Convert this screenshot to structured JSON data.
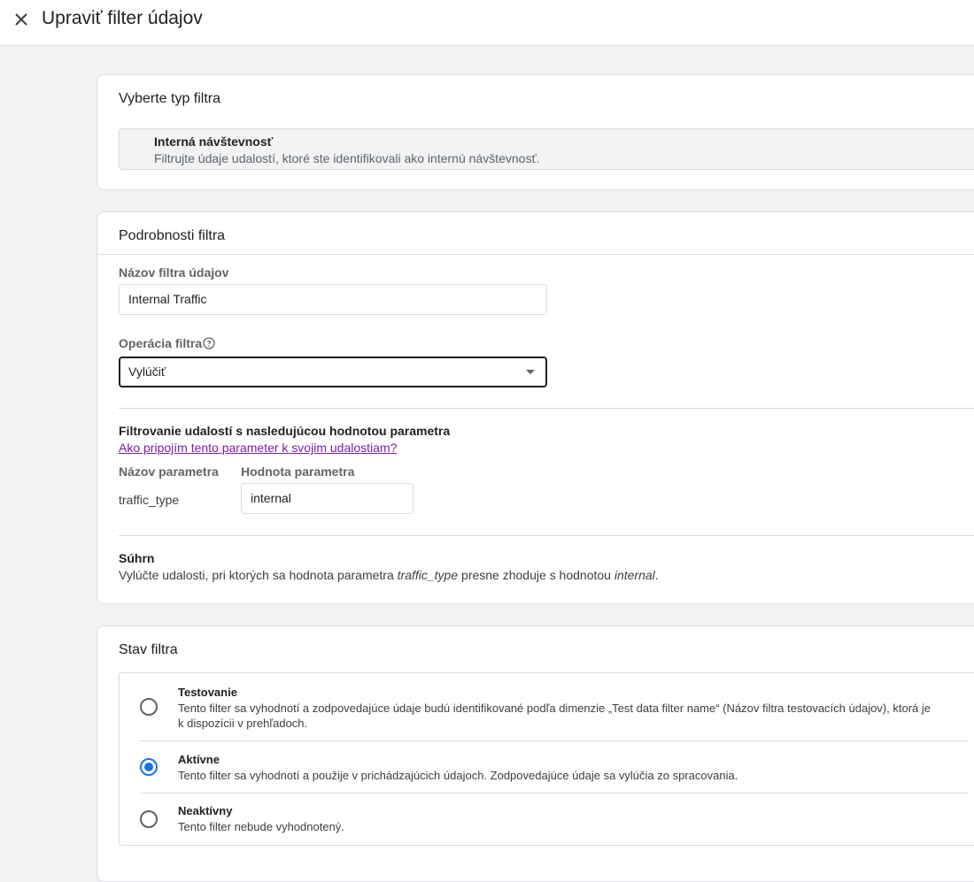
{
  "header": {
    "title": "Upraviť filter údajov"
  },
  "filter_type": {
    "title": "Vyberte typ filtra",
    "selected_name": "Interná návštevnosť",
    "selected_desc": "Filtrujte údaje udalostí, ktoré ste identifikovali ako internú návštevnosť."
  },
  "details": {
    "title": "Podrobnosti filtra",
    "name_label": "Názov filtra údajov",
    "name_value": "Internal Traffic",
    "operation_label": "Operácia filtra",
    "operation_value": "Vylúčiť",
    "param_heading": "Filtrovanie udalostí s nasledujúcou hodnotou parametra",
    "param_link": "Ako pripojím tento parameter k svojim udalostiam?",
    "param_name_label": "Názov parametra",
    "param_value_label": "Hodnota parametra",
    "param_name": "traffic_type",
    "param_value": "internal",
    "summary_heading": "Súhrn",
    "summary_pre": "Vylúčte udalosti, pri ktorých sa hodnota parametra ",
    "summary_param": "traffic_type",
    "summary_mid": " presne zhoduje s hodnotou ",
    "summary_value": "internal",
    "summary_end": "."
  },
  "status": {
    "title": "Stav filtra",
    "options": [
      {
        "title": "Testovanie",
        "desc_line1": "Tento filter sa vyhodnotí a zodpovedajúce údaje budú identifikované podľa dimenzie „Test data filter name“ (Názov filtra testovacích údajov), ktorá je",
        "desc_line2": "k dispozícii v prehľadoch.",
        "checked": false
      },
      {
        "title": "Aktívne",
        "desc_line1": "Tento filter sa vyhodnotí a použije v prichádzajúcich údajoch. Zodpovedajúce údaje sa vylúčia zo spracovania.",
        "checked": true
      },
      {
        "title": "Neaktívny",
        "desc_line1": "Tento filter nebude vyhodnotený.",
        "checked": false
      }
    ]
  },
  "colors": {
    "accent": "#1a73e8",
    "link": "#7b1fa2"
  }
}
